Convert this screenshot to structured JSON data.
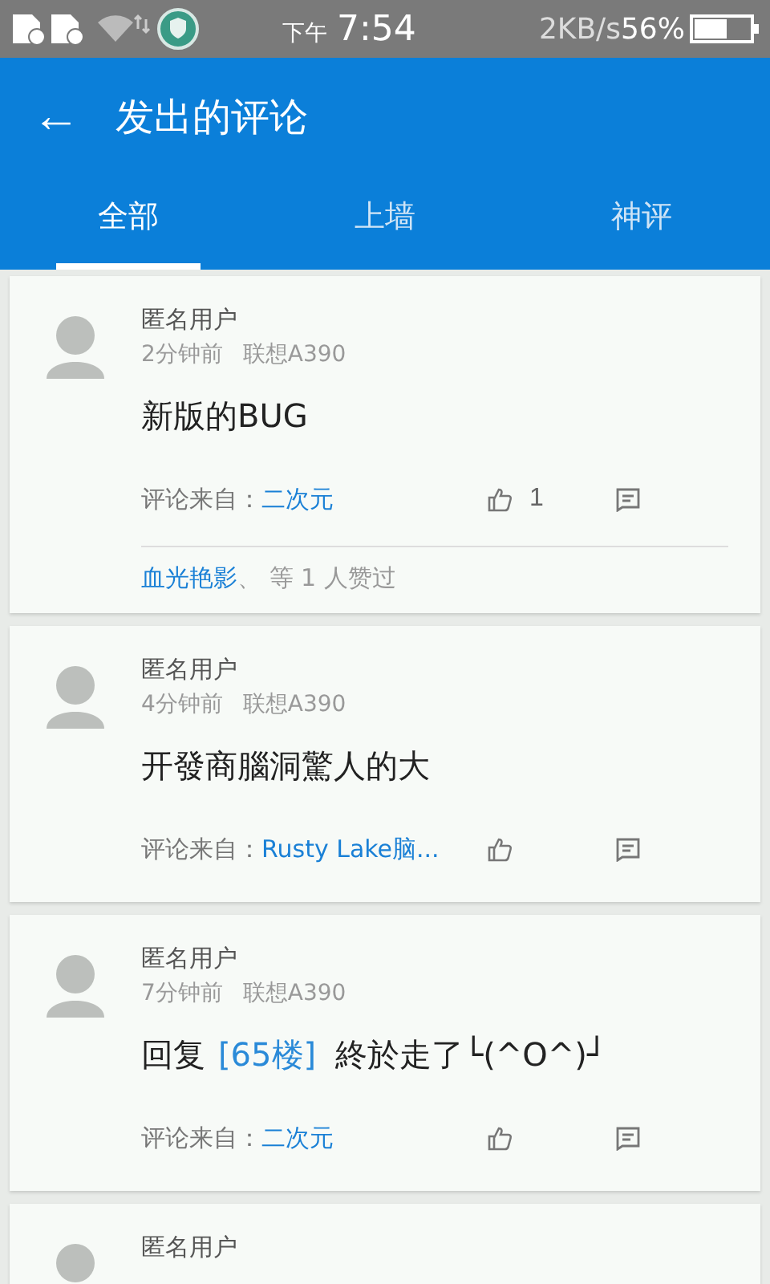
{
  "status_bar": {
    "period": "下午",
    "time": "7:54",
    "speed": "2KB/s",
    "battery": "56%"
  },
  "app_bar": {
    "back": "←",
    "title": "发出的评论"
  },
  "tabs": [
    {
      "label": "全部",
      "selected": true
    },
    {
      "label": "上墙",
      "selected": false
    },
    {
      "label": "神评",
      "selected": false
    }
  ],
  "comments": [
    {
      "user": "匿名用户",
      "time": "2分钟前",
      "device": "联想A390",
      "content": "新版的BUG",
      "source_label": "评论来自：",
      "source": "二次元",
      "likes": "1",
      "liked_by": "血光艳影",
      "liked_suffix": "、 等 1 人赞过"
    },
    {
      "user": "匿名用户",
      "time": "4分钟前",
      "device": "联想A390",
      "content": "开發商腦洞驚人的大",
      "source_label": "评论来自：",
      "source": "Rusty Lake脑..."
    },
    {
      "user": "匿名用户",
      "time": "7分钟前",
      "device": "联想A390",
      "reply_prefix": "回复",
      "reply_ref": "[65楼]",
      "content": "終於走了└(^O^)┘",
      "source_label": "评论来自：",
      "source": "二次元"
    },
    {
      "user": "匿名用户"
    }
  ]
}
